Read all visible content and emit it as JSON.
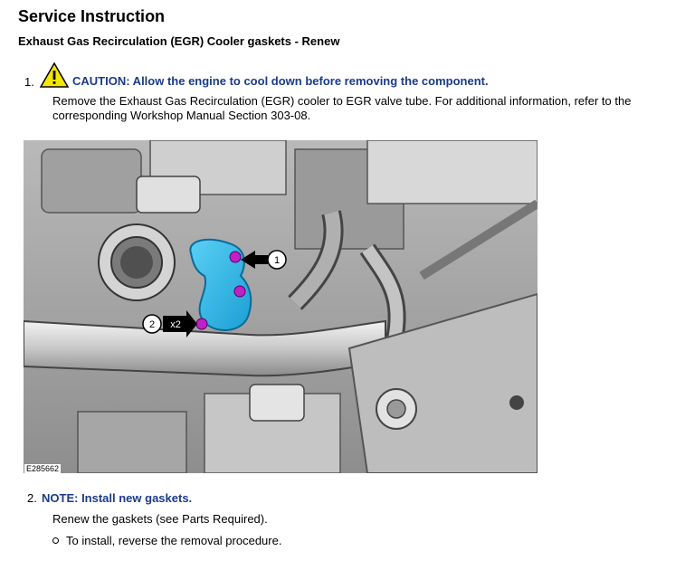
{
  "page": {
    "title": "Service Instruction",
    "subtitle": "Exhaust Gas Recirculation (EGR) Cooler gaskets - Renew"
  },
  "step1": {
    "number": "1.",
    "caution_label": "CAUTION:",
    "caution_text": " Allow the engine to cool down before removing the component.",
    "body": "Remove the Exhaust Gas Recirculation (EGR) cooler to EGR valve tube. For additional information, refer to the corresponding Workshop Manual Section 303-08.",
    "icon": "warning-triangle-icon"
  },
  "figure": {
    "id": "E285662",
    "callout1": "1",
    "callout2": "2",
    "callout2_qty": "x2",
    "highlight_color": "#29b6e8",
    "fastener_color": "#c020c8"
  },
  "step2": {
    "number": "2.",
    "note_label": "NOTE:",
    "note_text": " Install new gaskets.",
    "body": "Renew the gaskets (see Parts Required).",
    "bullet": "To install, reverse the removal procedure."
  }
}
